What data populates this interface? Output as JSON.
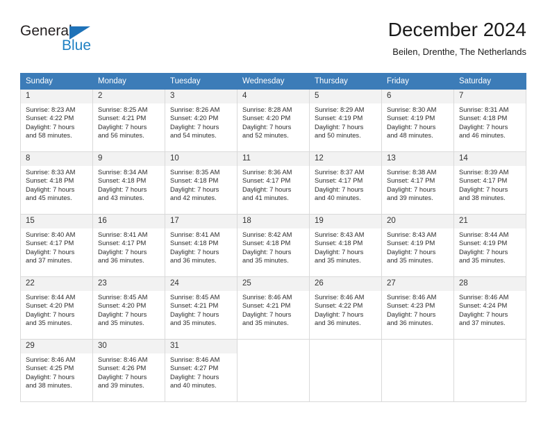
{
  "brand": {
    "word_one": "General",
    "word_two": "Blue",
    "triangle_icon": "triangle-icon",
    "accent_color": "#2081c3"
  },
  "header": {
    "title": "December 2024",
    "subtitle": "Beilen, Drenthe, The Netherlands"
  },
  "calendar": {
    "header_bg": "#3c7cb8",
    "weekday_headers": [
      "Sunday",
      "Monday",
      "Tuesday",
      "Wednesday",
      "Thursday",
      "Friday",
      "Saturday"
    ],
    "labels": {
      "sunrise": "Sunrise:",
      "sunset": "Sunset:",
      "daylight": "Daylight:"
    },
    "weeks": [
      [
        {
          "day": "1",
          "sunrise": "Sunrise: 8:23 AM",
          "sunset": "Sunset: 4:22 PM",
          "daylight_line1": "Daylight: 7 hours",
          "daylight_line2": "and 58 minutes."
        },
        {
          "day": "2",
          "sunrise": "Sunrise: 8:25 AM",
          "sunset": "Sunset: 4:21 PM",
          "daylight_line1": "Daylight: 7 hours",
          "daylight_line2": "and 56 minutes."
        },
        {
          "day": "3",
          "sunrise": "Sunrise: 8:26 AM",
          "sunset": "Sunset: 4:20 PM",
          "daylight_line1": "Daylight: 7 hours",
          "daylight_line2": "and 54 minutes."
        },
        {
          "day": "4",
          "sunrise": "Sunrise: 8:28 AM",
          "sunset": "Sunset: 4:20 PM",
          "daylight_line1": "Daylight: 7 hours",
          "daylight_line2": "and 52 minutes."
        },
        {
          "day": "5",
          "sunrise": "Sunrise: 8:29 AM",
          "sunset": "Sunset: 4:19 PM",
          "daylight_line1": "Daylight: 7 hours",
          "daylight_line2": "and 50 minutes."
        },
        {
          "day": "6",
          "sunrise": "Sunrise: 8:30 AM",
          "sunset": "Sunset: 4:19 PM",
          "daylight_line1": "Daylight: 7 hours",
          "daylight_line2": "and 48 minutes."
        },
        {
          "day": "7",
          "sunrise": "Sunrise: 8:31 AM",
          "sunset": "Sunset: 4:18 PM",
          "daylight_line1": "Daylight: 7 hours",
          "daylight_line2": "and 46 minutes."
        }
      ],
      [
        {
          "day": "8",
          "sunrise": "Sunrise: 8:33 AM",
          "sunset": "Sunset: 4:18 PM",
          "daylight_line1": "Daylight: 7 hours",
          "daylight_line2": "and 45 minutes."
        },
        {
          "day": "9",
          "sunrise": "Sunrise: 8:34 AM",
          "sunset": "Sunset: 4:18 PM",
          "daylight_line1": "Daylight: 7 hours",
          "daylight_line2": "and 43 minutes."
        },
        {
          "day": "10",
          "sunrise": "Sunrise: 8:35 AM",
          "sunset": "Sunset: 4:18 PM",
          "daylight_line1": "Daylight: 7 hours",
          "daylight_line2": "and 42 minutes."
        },
        {
          "day": "11",
          "sunrise": "Sunrise: 8:36 AM",
          "sunset": "Sunset: 4:17 PM",
          "daylight_line1": "Daylight: 7 hours",
          "daylight_line2": "and 41 minutes."
        },
        {
          "day": "12",
          "sunrise": "Sunrise: 8:37 AM",
          "sunset": "Sunset: 4:17 PM",
          "daylight_line1": "Daylight: 7 hours",
          "daylight_line2": "and 40 minutes."
        },
        {
          "day": "13",
          "sunrise": "Sunrise: 8:38 AM",
          "sunset": "Sunset: 4:17 PM",
          "daylight_line1": "Daylight: 7 hours",
          "daylight_line2": "and 39 minutes."
        },
        {
          "day": "14",
          "sunrise": "Sunrise: 8:39 AM",
          "sunset": "Sunset: 4:17 PM",
          "daylight_line1": "Daylight: 7 hours",
          "daylight_line2": "and 38 minutes."
        }
      ],
      [
        {
          "day": "15",
          "sunrise": "Sunrise: 8:40 AM",
          "sunset": "Sunset: 4:17 PM",
          "daylight_line1": "Daylight: 7 hours",
          "daylight_line2": "and 37 minutes."
        },
        {
          "day": "16",
          "sunrise": "Sunrise: 8:41 AM",
          "sunset": "Sunset: 4:17 PM",
          "daylight_line1": "Daylight: 7 hours",
          "daylight_line2": "and 36 minutes."
        },
        {
          "day": "17",
          "sunrise": "Sunrise: 8:41 AM",
          "sunset": "Sunset: 4:18 PM",
          "daylight_line1": "Daylight: 7 hours",
          "daylight_line2": "and 36 minutes."
        },
        {
          "day": "18",
          "sunrise": "Sunrise: 8:42 AM",
          "sunset": "Sunset: 4:18 PM",
          "daylight_line1": "Daylight: 7 hours",
          "daylight_line2": "and 35 minutes."
        },
        {
          "day": "19",
          "sunrise": "Sunrise: 8:43 AM",
          "sunset": "Sunset: 4:18 PM",
          "daylight_line1": "Daylight: 7 hours",
          "daylight_line2": "and 35 minutes."
        },
        {
          "day": "20",
          "sunrise": "Sunrise: 8:43 AM",
          "sunset": "Sunset: 4:19 PM",
          "daylight_line1": "Daylight: 7 hours",
          "daylight_line2": "and 35 minutes."
        },
        {
          "day": "21",
          "sunrise": "Sunrise: 8:44 AM",
          "sunset": "Sunset: 4:19 PM",
          "daylight_line1": "Daylight: 7 hours",
          "daylight_line2": "and 35 minutes."
        }
      ],
      [
        {
          "day": "22",
          "sunrise": "Sunrise: 8:44 AM",
          "sunset": "Sunset: 4:20 PM",
          "daylight_line1": "Daylight: 7 hours",
          "daylight_line2": "and 35 minutes."
        },
        {
          "day": "23",
          "sunrise": "Sunrise: 8:45 AM",
          "sunset": "Sunset: 4:20 PM",
          "daylight_line1": "Daylight: 7 hours",
          "daylight_line2": "and 35 minutes."
        },
        {
          "day": "24",
          "sunrise": "Sunrise: 8:45 AM",
          "sunset": "Sunset: 4:21 PM",
          "daylight_line1": "Daylight: 7 hours",
          "daylight_line2": "and 35 minutes."
        },
        {
          "day": "25",
          "sunrise": "Sunrise: 8:46 AM",
          "sunset": "Sunset: 4:21 PM",
          "daylight_line1": "Daylight: 7 hours",
          "daylight_line2": "and 35 minutes."
        },
        {
          "day": "26",
          "sunrise": "Sunrise: 8:46 AM",
          "sunset": "Sunset: 4:22 PM",
          "daylight_line1": "Daylight: 7 hours",
          "daylight_line2": "and 36 minutes."
        },
        {
          "day": "27",
          "sunrise": "Sunrise: 8:46 AM",
          "sunset": "Sunset: 4:23 PM",
          "daylight_line1": "Daylight: 7 hours",
          "daylight_line2": "and 36 minutes."
        },
        {
          "day": "28",
          "sunrise": "Sunrise: 8:46 AM",
          "sunset": "Sunset: 4:24 PM",
          "daylight_line1": "Daylight: 7 hours",
          "daylight_line2": "and 37 minutes."
        }
      ],
      [
        {
          "day": "29",
          "sunrise": "Sunrise: 8:46 AM",
          "sunset": "Sunset: 4:25 PM",
          "daylight_line1": "Daylight: 7 hours",
          "daylight_line2": "and 38 minutes."
        },
        {
          "day": "30",
          "sunrise": "Sunrise: 8:46 AM",
          "sunset": "Sunset: 4:26 PM",
          "daylight_line1": "Daylight: 7 hours",
          "daylight_line2": "and 39 minutes."
        },
        {
          "day": "31",
          "sunrise": "Sunrise: 8:46 AM",
          "sunset": "Sunset: 4:27 PM",
          "daylight_line1": "Daylight: 7 hours",
          "daylight_line2": "and 40 minutes."
        },
        {
          "day": "",
          "sunrise": "",
          "sunset": "",
          "daylight_line1": "",
          "daylight_line2": ""
        },
        {
          "day": "",
          "sunrise": "",
          "sunset": "",
          "daylight_line1": "",
          "daylight_line2": ""
        },
        {
          "day": "",
          "sunrise": "",
          "sunset": "",
          "daylight_line1": "",
          "daylight_line2": ""
        },
        {
          "day": "",
          "sunrise": "",
          "sunset": "",
          "daylight_line1": "",
          "daylight_line2": ""
        }
      ]
    ]
  }
}
